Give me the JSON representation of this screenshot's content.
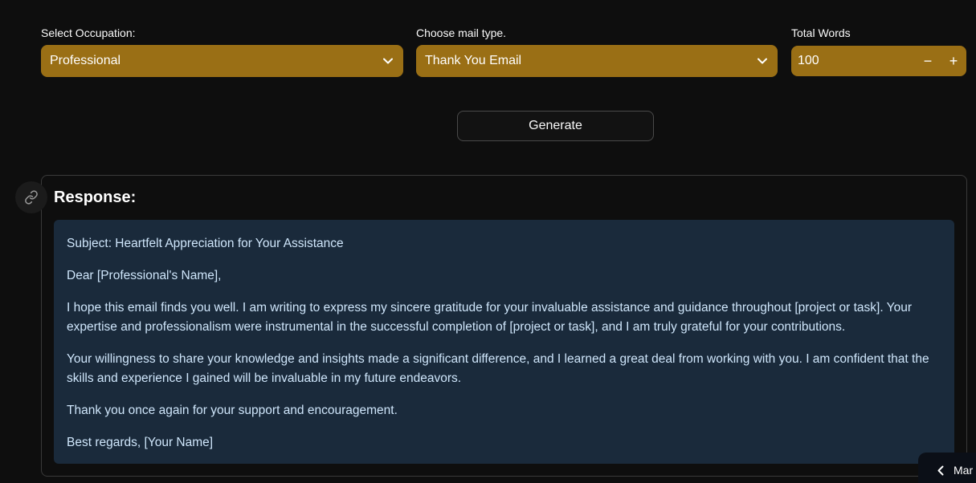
{
  "occupation": {
    "label": "Select Occupation:",
    "value": "Professional"
  },
  "mail_type": {
    "label": "Choose mail type.",
    "value": "Thank You Email"
  },
  "total_words": {
    "label": "Total Words",
    "value": "100",
    "minus": "−",
    "plus": "+"
  },
  "generate_label": "Generate",
  "response": {
    "title": "Response:",
    "paragraphs": [
      "Subject: Heartfelt Appreciation for Your Assistance",
      "Dear [Professional's Name],",
      "I hope this email finds you well. I am writing to express my sincere gratitude for your invaluable assistance and guidance throughout [project or task]. Your expertise and professionalism were instrumental in the successful completion of [project or task], and I am truly grateful for your contributions.",
      "Your willingness to share your knowledge and insights made a significant difference, and I learned a great deal from working with you. I am confident that the skills and experience I gained will be invaluable in my future endeavors.",
      "Thank you once again for your support and encouragement.",
      "Best regards, [Your Name]"
    ]
  },
  "side_tab_label": "Mar",
  "colors": {
    "accent": "#9a6f15",
    "response_bg": "#1a2a3b",
    "background": "#0e0e0e"
  },
  "icons": {
    "dropdown": "chevron-down-icon",
    "anchor": "link-icon",
    "collapse": "chevron-left-icon"
  }
}
